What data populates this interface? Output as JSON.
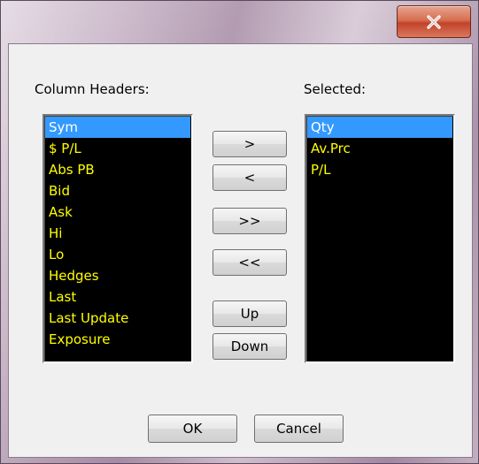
{
  "window": {
    "close_icon": "close-icon"
  },
  "left": {
    "label": "Column Headers:",
    "items": [
      {
        "label": "Sym",
        "selected": true
      },
      {
        "label": "$ P/L",
        "selected": false
      },
      {
        "label": "Abs PB",
        "selected": false
      },
      {
        "label": "Bid",
        "selected": false
      },
      {
        "label": "Ask",
        "selected": false
      },
      {
        "label": "Hi",
        "selected": false
      },
      {
        "label": "Lo",
        "selected": false
      },
      {
        "label": "Hedges",
        "selected": false
      },
      {
        "label": "Last",
        "selected": false
      },
      {
        "label": "Last Update",
        "selected": false
      },
      {
        "label": "Exposure",
        "selected": false
      }
    ]
  },
  "right": {
    "label": "Selected:",
    "items": [
      {
        "label": "Qty",
        "selected": true
      },
      {
        "label": "Av.Prc",
        "selected": false
      },
      {
        "label": "P/L",
        "selected": false
      }
    ]
  },
  "buttons": {
    "add": ">",
    "remove": "<",
    "add_all": ">>",
    "remove_all": "<<",
    "up": "Up",
    "down": "Down",
    "ok": "OK",
    "cancel": "Cancel"
  },
  "colors": {
    "list_background": "#000000",
    "list_text": "#ffff00",
    "selection": "#3399ff",
    "close_button": "#c2432a"
  }
}
